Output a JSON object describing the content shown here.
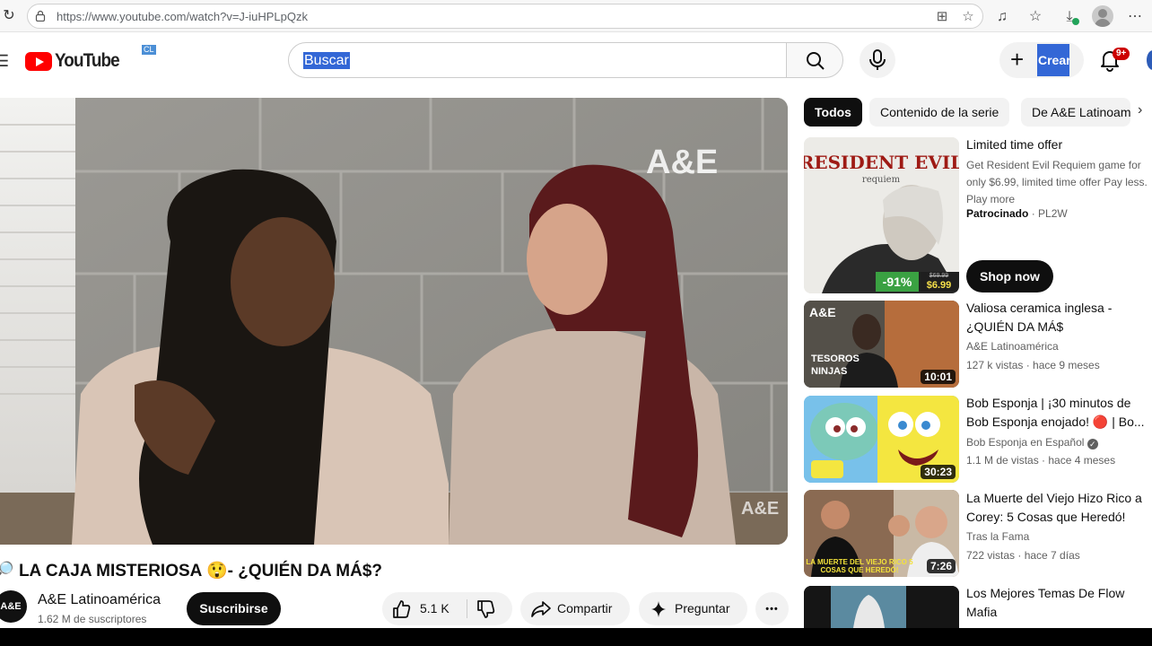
{
  "browser": {
    "url": "https://www.youtube.com/watch?v=J-iuHPLpQzk"
  },
  "header": {
    "logo_text": "YouTube",
    "region": "CL",
    "search_value": "Buscar",
    "create_label": "Crear",
    "notifications_badge": "9+"
  },
  "video": {
    "watermark": "A&E",
    "title_prefix": "🔎",
    "title": "LA CAJA MISTERIOSA 😲- ¿QUIÉN DA MÁ$?",
    "channel_avatar_text": "A&E",
    "channel_name": "A&E Latinoamérica",
    "subscribers": "1.62 M de suscriptores",
    "subscribe_label": "Suscribirse",
    "likes": "5.1 K",
    "share_label": "Compartir",
    "ask_label": "Preguntar",
    "more_label": "•••"
  },
  "chips": [
    {
      "label": "Todos",
      "active": true
    },
    {
      "label": "Contenido de la serie",
      "active": false
    },
    {
      "label": "De A&E Latinoamérica",
      "active": false
    }
  ],
  "ad": {
    "title": "Limited time offer",
    "description": "Get Resident Evil Requiem game for only $6.99, limited time offer Pay less. Play more",
    "sponsor_label": "Patrocinado",
    "sponsor_name": "PL2W",
    "cta": "Shop now",
    "thumb_title": "RESIDENT EVIL",
    "thumb_subtitle": "requiem",
    "discount": "-91%",
    "old_price": "$69.99",
    "price": "$6.99"
  },
  "recommendations": [
    {
      "title": "Valiosa ceramica inglesa - ¿QUIÉN DA MÁ$",
      "channel": "A&E Latinoamérica",
      "meta": "127 k vistas · hace 9 meses",
      "duration": "10:01",
      "thumb_text": "TESOROS NINJAS",
      "thumb_logo": "A&E",
      "verified": false
    },
    {
      "title": "Bob Esponja | ¡30 minutos de Bob Esponja enojado! 🔴 | Bo...",
      "channel": "Bob Esponja en Español",
      "meta": "1.1 M de vistas · hace 4 meses",
      "duration": "30:23",
      "verified": true
    },
    {
      "title": "La Muerte del Viejo Hizo Rico a Corey: 5 Cosas que Heredó!",
      "channel": "Tras la Fama",
      "meta": "722 vistas · hace 7 días",
      "duration": "7:26",
      "thumb_text": "LA MUERTE DEL VIEJO RICO 5 COSAS QUE HEREDÓ!",
      "verified": false
    },
    {
      "title": "Los Mejores Temas De Flow Mafia",
      "channel": "",
      "meta": "",
      "duration": "",
      "verified": false
    }
  ],
  "colors": {
    "youtube_red": "#ff0000",
    "selection_blue": "#3367d6",
    "chip_bg": "#f2f2f2",
    "text_secondary": "#606060"
  }
}
